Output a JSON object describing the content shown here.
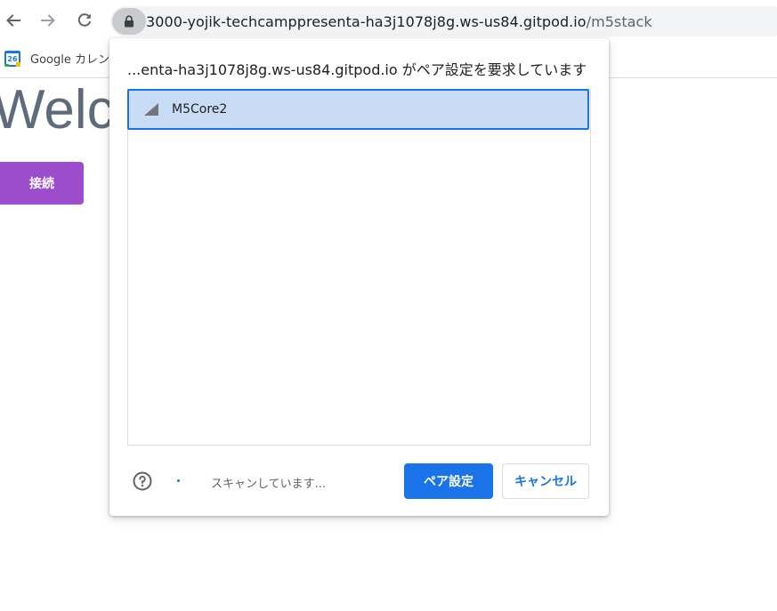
{
  "browser": {
    "url_host": "3000-yojik-techcamppresenta-ha3j1078j8g.ws-us84.gitpod.io",
    "url_path": "/m5stack",
    "bookmarks": [
      {
        "label": "Google カレンダ",
        "icon": "google-calendar-icon",
        "icon_text": "26"
      }
    ]
  },
  "page": {
    "heading": "Welcome",
    "connect_label": "接続",
    "connect_color": "#9c4dcc"
  },
  "dialog": {
    "title": "...enta-ha3j1078j8g.ws-us84.gitpod.io がペア設定を要求しています",
    "devices": [
      {
        "name": "M5Core2",
        "icon": "signal-strength-icon",
        "selected": true
      }
    ],
    "status": "スキャンしています...",
    "pair_label": "ペア設定",
    "cancel_label": "キャンセル",
    "accent_color": "#1a73e8",
    "selection_color": "#c9dcf6"
  }
}
